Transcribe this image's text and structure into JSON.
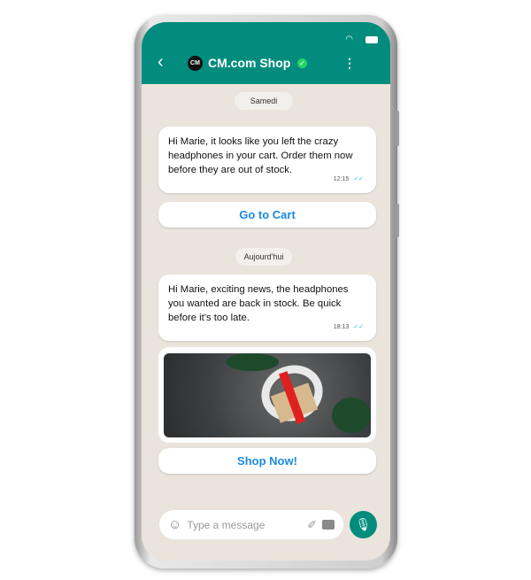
{
  "header": {
    "title": "CM.com Shop",
    "avatar_text": "CM",
    "back_icon": "chevron-left-icon",
    "menu_icon": "more-vertical-icon",
    "verified_icon": "verified-check-icon"
  },
  "colors": {
    "header": "#028c7e",
    "link": "#1b8be0",
    "read_ticks": "#34b7f1"
  },
  "messages": [
    {
      "date": "Samedi",
      "text": "Hi Marie, it looks like you left the crazy headphones in your cart. Order them now before they are out of stock.",
      "time": "12:15",
      "button": "Go to Cart"
    },
    {
      "date": "Aujourd'hui",
      "text": "Hi Marie, exciting news, the headphones you wanted are back in stock. Be quick before it's too late.",
      "time": "18:13",
      "button": "Shop Now!"
    }
  ],
  "composer": {
    "placeholder": "Type a message"
  }
}
